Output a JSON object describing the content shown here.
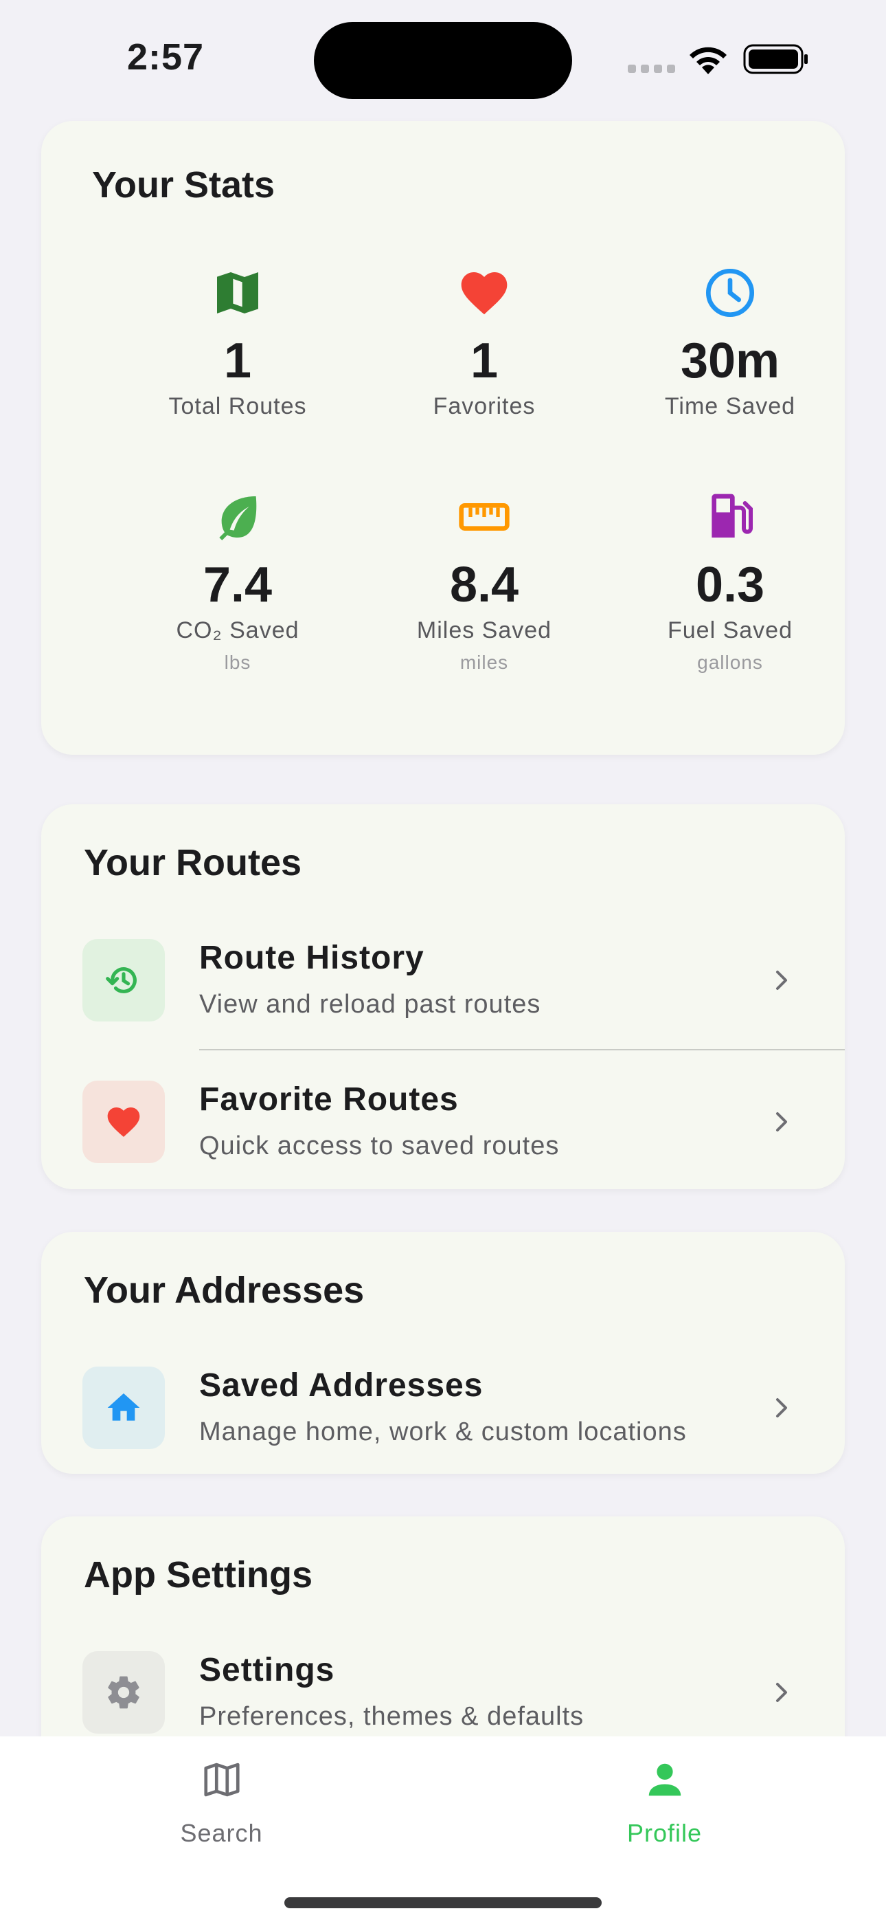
{
  "status_bar": {
    "time": "2:57"
  },
  "stats": {
    "title": "Your Stats",
    "items": [
      {
        "icon": "map-icon",
        "color": "#2e7d32",
        "value": "1",
        "label": "Total Routes",
        "unit": ""
      },
      {
        "icon": "heart-icon",
        "color": "#f44336",
        "value": "1",
        "label": "Favorites",
        "unit": ""
      },
      {
        "icon": "clock-icon",
        "color": "#2196f3",
        "value": "30m",
        "label": "Time Saved",
        "unit": ""
      },
      {
        "icon": "leaf-icon",
        "color": "#4caf50",
        "value": "7.4",
        "label": "CO₂ Saved",
        "unit": "lbs"
      },
      {
        "icon": "ruler-icon",
        "color": "#ff9800",
        "value": "8.4",
        "label": "Miles Saved",
        "unit": "miles"
      },
      {
        "icon": "fuel-pump-icon",
        "color": "#9c27b0",
        "value": "0.3",
        "label": "Fuel Saved",
        "unit": "gallons"
      }
    ]
  },
  "routes": {
    "title": "Your Routes",
    "items": [
      {
        "icon": "history-icon",
        "title": "Route History",
        "subtitle": "View and reload past routes"
      },
      {
        "icon": "heart-icon",
        "title": "Favorite Routes",
        "subtitle": "Quick access to saved routes"
      }
    ]
  },
  "addresses": {
    "title": "Your Addresses",
    "items": [
      {
        "icon": "home-icon",
        "title": "Saved Addresses",
        "subtitle": "Manage home, work & custom locations"
      }
    ]
  },
  "app_settings": {
    "title": "App Settings",
    "items": [
      {
        "icon": "gear-icon",
        "title": "Settings",
        "subtitle": "Preferences, themes & defaults"
      }
    ]
  },
  "tab_bar": {
    "tabs": [
      {
        "icon": "map-outline-icon",
        "label": "Search",
        "active": false
      },
      {
        "icon": "person-icon",
        "label": "Profile",
        "active": true
      }
    ],
    "active_color": "#34c759",
    "inactive_color": "#6d6d72"
  },
  "colors": {
    "background": "#f2f1f6",
    "card": "#f6f8f1",
    "accent": "#34c759"
  }
}
